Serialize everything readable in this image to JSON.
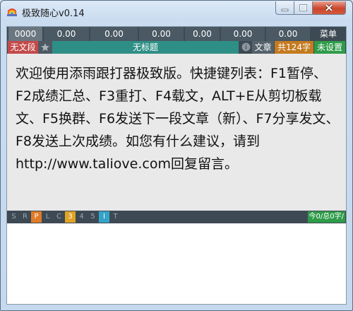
{
  "window": {
    "title": "极致随心v0.14",
    "controls": {
      "minimize": "–",
      "maximize": "□",
      "close": "✕"
    }
  },
  "stats_bar": {
    "values": [
      "0000",
      "0.00",
      "0.00",
      "0.00",
      "0.00",
      "0.00",
      "0.00"
    ],
    "menu_label": "菜单"
  },
  "info_bar": {
    "segment_label": "无文段",
    "star_icon": "star-icon",
    "article_title": "无标题",
    "article_label": "文章",
    "char_total": "共124字",
    "settings_label": "未设置",
    "colors": {
      "segment": "#c44a4a",
      "title": "#2e8f86",
      "count": "#c47b20",
      "settings": "#2e9b49"
    }
  },
  "passage": {
    "text": "欢迎使用添雨跟打器极致版。快捷键列表：F1暂停、F2成绩汇总、F3重打、F4载文，ALT+E从剪切板载文、F5换群、F6发送下一段文章（新）、F7分享发文、F8发送上次成绩。如您有什么建议，请到http://www.taliove.com回复留言。"
  },
  "status_bar": {
    "toggles": [
      {
        "label": "S",
        "active": false
      },
      {
        "label": "R",
        "active": false
      },
      {
        "label": "P",
        "active": true
      },
      {
        "label": "L",
        "active": false
      },
      {
        "label": "C",
        "active": false
      },
      {
        "label": "3",
        "active": true
      },
      {
        "label": "4",
        "active": false
      },
      {
        "label": "5",
        "active": false
      },
      {
        "label": "I",
        "active": true
      },
      {
        "label": "T",
        "active": false
      }
    ],
    "progress": "今0/总0字/"
  },
  "input": {
    "value": ""
  }
}
